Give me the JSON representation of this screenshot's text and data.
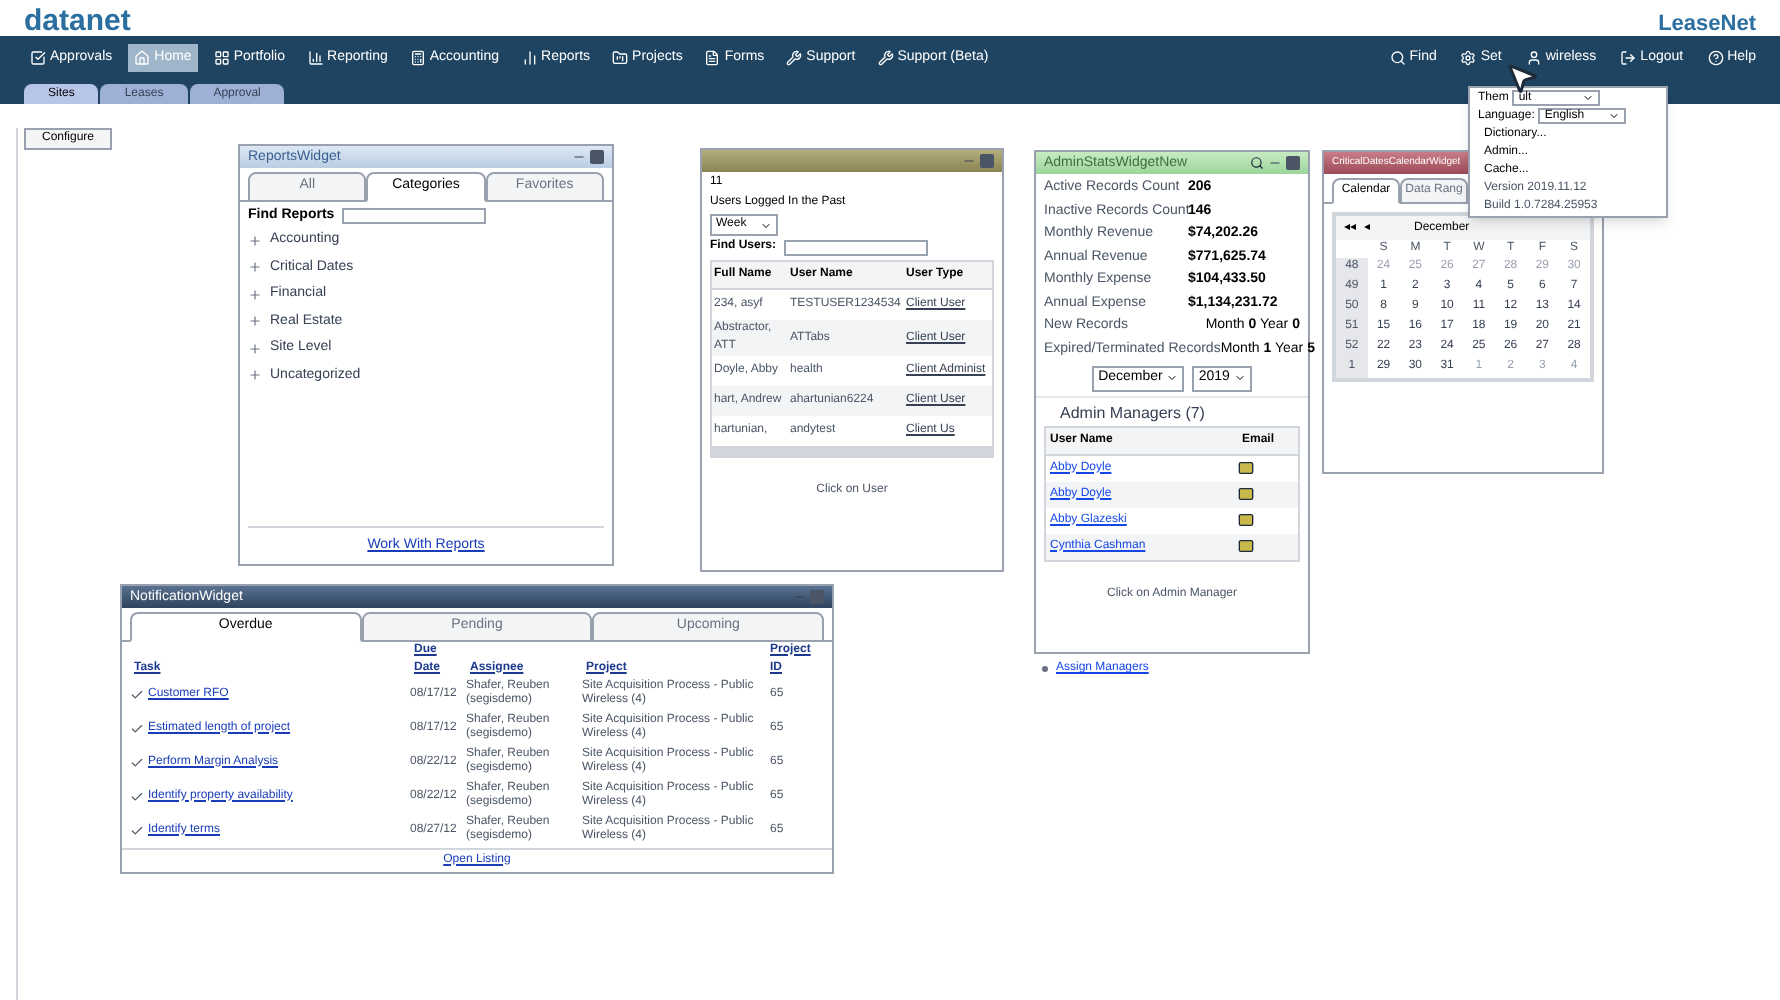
{
  "logo": "datanet",
  "brand": "LeaseNet",
  "nav": [
    {
      "label": "Approvals",
      "selected": false
    },
    {
      "label": "Home",
      "selected": true
    },
    {
      "label": "Portfolio",
      "selected": false
    },
    {
      "label": "Reporting",
      "selected": false
    },
    {
      "label": "Accounting",
      "selected": false
    },
    {
      "label": "Reports",
      "selected": false
    },
    {
      "label": "Projects",
      "selected": false
    },
    {
      "label": "Forms",
      "selected": false
    },
    {
      "label": "Support",
      "selected": false
    },
    {
      "label": "Support (Beta)",
      "selected": false
    }
  ],
  "nav_right": [
    "Find",
    "Set",
    "wireless",
    "Logout",
    "Help"
  ],
  "subtabs": [
    {
      "label": "Sites",
      "selected": true
    },
    {
      "label": "Leases",
      "selected": false
    },
    {
      "label": "Approval",
      "selected": false
    }
  ],
  "configure_button": "Configure",
  "settings_menu": [
    {
      "kind": "select",
      "label": "Them",
      "value": "ult"
    },
    {
      "kind": "select",
      "label": "Language:",
      "value": "English"
    },
    {
      "kind": "item",
      "label": "Dictionary..."
    },
    {
      "kind": "item",
      "label": "Admin..."
    },
    {
      "kind": "item",
      "label": "Cache..."
    },
    {
      "kind": "info",
      "label": "Version 2019.11.12"
    },
    {
      "kind": "info",
      "label": "Build 1.0.7284.25953"
    }
  ],
  "reports_widget": {
    "title": "ReportsWidget",
    "tabs": [
      {
        "label": "All",
        "selected": false
      },
      {
        "label": "Categories",
        "selected": true
      },
      {
        "label": "Favorites",
        "selected": false
      }
    ],
    "search_label": "Find Reports",
    "categories": [
      "Accounting",
      "Critical Dates",
      "Financial",
      "Real Estate",
      "Site Level",
      "Uncategorized"
    ],
    "footer_link": "Work With Reports"
  },
  "users_widget": {
    "count": "11",
    "caption": "Users Logged In the Past",
    "period": "Week",
    "search_label": "Find Users:",
    "columns": [
      "Full Name",
      "User Name",
      "User Type"
    ],
    "rows": [
      [
        "234, asyf",
        "TESTUSER1234534",
        "Client User"
      ],
      [
        "Abstractor, ATT",
        "ATTabs",
        "Client User"
      ],
      [
        "Doyle, Abby",
        "health",
        "Client Administ"
      ],
      [
        "hart, Andrew",
        "ahartunian6224",
        "Client User"
      ],
      [
        "hartunian,",
        "andytest",
        "Client Us"
      ]
    ],
    "hint": "Click on User"
  },
  "admin_widget": {
    "title": "AdminStatsWidgetNew",
    "stats": [
      [
        "Active Records Count",
        "206"
      ],
      [
        "Inactive Records Count",
        "146"
      ],
      [
        "Monthly Revenue",
        "$74,202.26"
      ],
      [
        "Annual Revenue",
        "$771,625.74"
      ],
      [
        "Monthly Expense",
        "$104,433.50"
      ],
      [
        "Annual Expense",
        "$1,134,231.72"
      ]
    ],
    "new_records": {
      "label": "New Records",
      "month_label": "Month",
      "month": "0",
      "year_label": "Year",
      "year": "0"
    },
    "expired_records": {
      "label": "Expired/Terminated Records",
      "month_label": "Month",
      "month": "1",
      "year_label": "Year",
      "year": "5"
    },
    "month": "December",
    "year": "2019",
    "managers_heading": "Admin Managers (7)",
    "columns": [
      "User Name",
      "Email"
    ],
    "managers": [
      "Abby Doyle",
      "Abby Doyle",
      "Abby Glazeski",
      "Cynthia Cashman"
    ],
    "hint": "Click on Admin Manager",
    "link": "Assign Managers"
  },
  "calendar_widget": {
    "title": "CriticalDatesCalendarWidget",
    "tabs": [
      {
        "label": "Calendar",
        "selected": true
      },
      {
        "label": "Data Rang",
        "selected": false
      }
    ],
    "nav_prev": "◂◂",
    "nav_prev_one": "◂",
    "month": "December",
    "weekdays": [
      "S",
      "M",
      "T",
      "W",
      "T",
      "F",
      "S"
    ],
    "weeks": [
      {
        "week": "48",
        "days": [
          "24",
          "25",
          "26",
          "27",
          "28",
          "29",
          "30"
        ],
        "outside": [
          true,
          true,
          true,
          true,
          true,
          true,
          true
        ]
      },
      {
        "week": "49",
        "days": [
          "1",
          "2",
          "3",
          "4",
          "5",
          "6",
          "7"
        ],
        "outside": [
          false,
          false,
          false,
          false,
          false,
          false,
          false
        ]
      },
      {
        "week": "50",
        "days": [
          "8",
          "9",
          "10",
          "11",
          "12",
          "13",
          "14"
        ],
        "outside": [
          false,
          false,
          false,
          false,
          false,
          false,
          false
        ]
      },
      {
        "week": "51",
        "days": [
          "15",
          "16",
          "17",
          "18",
          "19",
          "20",
          "21"
        ],
        "outside": [
          false,
          false,
          false,
          false,
          false,
          false,
          false
        ]
      },
      {
        "week": "52",
        "days": [
          "22",
          "23",
          "24",
          "25",
          "26",
          "27",
          "28"
        ],
        "outside": [
          false,
          false,
          false,
          false,
          false,
          false,
          false
        ]
      },
      {
        "week": "1",
        "days": [
          "29",
          "30",
          "31",
          "1",
          "2",
          "3",
          "4"
        ],
        "outside": [
          false,
          false,
          false,
          true,
          true,
          true,
          true
        ]
      }
    ]
  },
  "notification_widget": {
    "title": "NotificationWidget",
    "tabs": [
      {
        "label": "Overdue",
        "selected": true
      },
      {
        "label": "Pending",
        "selected": false
      },
      {
        "label": "Upcoming",
        "selected": false
      }
    ],
    "columns": [
      "Task",
      "Due Date",
      "Assignee",
      "Project",
      "Project ID"
    ],
    "rows": [
      {
        "task": "Customer RFO",
        "due": "08/17/12",
        "assignee": "Shafer, Reuben (segisdemo)",
        "project": "Site Acquisition Process - Public Wireless (4)",
        "id": "65",
        "done": true
      },
      {
        "task": "Estimated length of project",
        "due": "08/17/12",
        "assignee": "Shafer, Reuben (segisdemo)",
        "project": "Site Acquisition Process - Public Wireless (4)",
        "id": "65",
        "done": true
      },
      {
        "task": "Perform Margin Analysis",
        "due": "08/22/12",
        "assignee": "Shafer, Reuben (segisdemo)",
        "project": "Site Acquisition Process - Public Wireless (4)",
        "id": "65",
        "done": true
      },
      {
        "task": "Identify property availability",
        "due": "08/22/12",
        "assignee": "Shafer, Reuben (segisdemo)",
        "project": "Site Acquisition Process - Public Wireless (4)",
        "id": "65",
        "done": true
      },
      {
        "task": "Identify terms",
        "due": "08/27/12",
        "assignee": "Shafer, Reuben (segisdemo)",
        "project": "Site Acquisition Process - Public Wireless (4)",
        "id": "65",
        "done": true
      }
    ],
    "footer_link": "Open Listing"
  }
}
